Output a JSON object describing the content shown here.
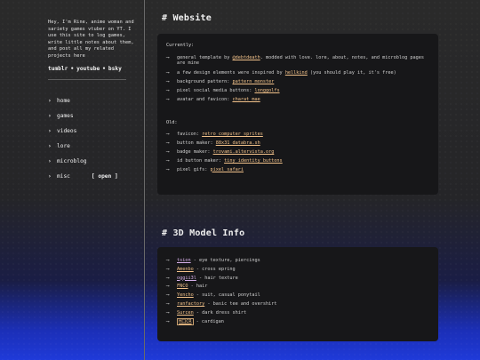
{
  "sidebar": {
    "bio": "Hey, I'm Rine, anime woman and sariety games vtuber on YT. I use this site to log games, write little notes about them, and post all my related projects here",
    "social": {
      "tumblr": "tumblr",
      "youtube": "youtube",
      "bsky": "bsky",
      "sep": "•"
    },
    "nav": [
      {
        "label": "home"
      },
      {
        "label": "games"
      },
      {
        "label": "videos"
      },
      {
        "label": "lore"
      },
      {
        "label": "microblog"
      },
      {
        "label": "misc",
        "extra": "[ open ]"
      }
    ],
    "chevron": "›"
  },
  "website": {
    "heading": "# Website",
    "currently_label": "Currently:",
    "arrow": "⟶",
    "currently": [
      {
        "pre": "general template by ",
        "link": "@debtdeath",
        "post": ". modded with love. lore, about, notes, and microblog pages are mine"
      },
      {
        "pre": "a few design elements were inspired by ",
        "link": "hellkind",
        "post": " (you should play it, it's free)"
      },
      {
        "pre": "background pattern: ",
        "link": "pattern monster",
        "post": ""
      },
      {
        "pre": "pixel social media buttons: ",
        "link": "longgolfs",
        "post": ""
      },
      {
        "pre": "avatar and favicon: ",
        "link": "charat mae",
        "post": ""
      }
    ],
    "old_label": "Old:",
    "old": [
      {
        "pre": "favicon: ",
        "link": "retro computer sprites",
        "post": ""
      },
      {
        "pre": "button maker: ",
        "link": "88x31 databra.sh",
        "post": ""
      },
      {
        "pre": "badge maker: ",
        "link": "trovami.altervista.org",
        "post": ""
      },
      {
        "pre": "id button maker: ",
        "link": "tiny identity buttons",
        "post": ""
      },
      {
        "pre": "pixel gifs: ",
        "link": "pixel safari",
        "post": ""
      }
    ]
  },
  "model": {
    "heading": "# 3D Model Info",
    "items": [
      {
        "link": "tsion",
        "post": " - eye texture, piercings"
      },
      {
        "link": "Amenbo",
        "post": " - cross epring"
      },
      {
        "link": "oggii3l",
        "post": " - hair texture"
      },
      {
        "link": "FNCO",
        "post": " - hair"
      },
      {
        "link": "Yencho",
        "post": " - suit, casual ponytail"
      },
      {
        "link": "ranfactory",
        "post": " - basic tee and overshirt"
      },
      {
        "link": "Surcen",
        "post": " - dark dress shirt"
      },
      {
        "link": "H口CR",
        "post": " - cardigan",
        "boxed": true
      }
    ]
  }
}
